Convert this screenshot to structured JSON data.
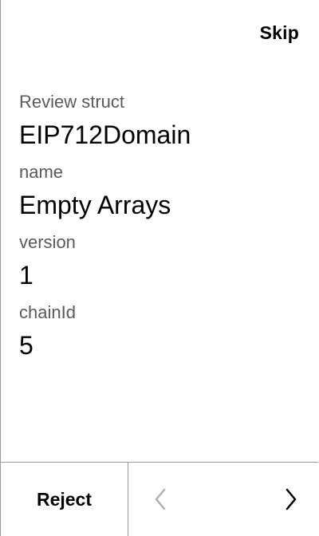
{
  "header": {
    "skip_label": "Skip"
  },
  "review": {
    "title_label": "Review struct",
    "title_value": "EIP712Domain",
    "fields": [
      {
        "label": "name",
        "value": "Empty Arrays"
      },
      {
        "label": "version",
        "value": "1"
      },
      {
        "label": "chainId",
        "value": "5"
      }
    ]
  },
  "footer": {
    "reject_label": "Reject",
    "prev_icon": "chevron-left-icon",
    "next_icon": "chevron-right-icon",
    "prev_color": "#b0b0b0",
    "next_color": "#000000"
  }
}
